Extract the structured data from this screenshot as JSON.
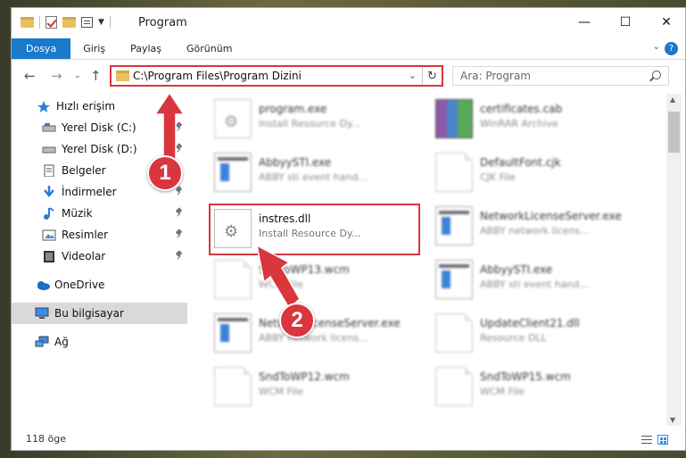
{
  "window": {
    "title": "Program",
    "controls": {
      "minimize": "—",
      "maximize": "☐",
      "close": "✕"
    }
  },
  "ribbon": {
    "tabs": [
      {
        "label": "Dosya",
        "active": true
      },
      {
        "label": "Giriş"
      },
      {
        "label": "Paylaş"
      },
      {
        "label": "Görünüm"
      }
    ],
    "help": "?"
  },
  "navbar": {
    "back": "←",
    "forward": "→",
    "recent": "⌄",
    "up": "↑",
    "address": "C:\\Program Files\\Program Dizini",
    "refresh": "↻",
    "search_placeholder": "Ara: Program"
  },
  "sidebar": {
    "items": [
      {
        "label": "Hızlı erişim",
        "icon": "star-icon"
      },
      {
        "label": "Yerel Disk (C:)",
        "icon": "drive-icon",
        "pinned": true
      },
      {
        "label": "Yerel Disk (D:)",
        "icon": "drive-icon",
        "pinned": true
      },
      {
        "label": "Belgeler",
        "icon": "documents-icon",
        "pinned": true
      },
      {
        "label": "İndirmeler",
        "icon": "download-icon",
        "pinned": true
      },
      {
        "label": "Müzik",
        "icon": "music-icon",
        "pinned": true
      },
      {
        "label": "Resimler",
        "icon": "pictures-icon",
        "pinned": true
      },
      {
        "label": "Videolar",
        "icon": "videos-icon",
        "pinned": true
      },
      {
        "label": "OneDrive",
        "icon": "cloud-icon"
      },
      {
        "label": "Bu bilgisayar",
        "icon": "computer-icon",
        "selected": true
      },
      {
        "label": "Ağ",
        "icon": "network-icon"
      }
    ]
  },
  "files": [
    {
      "name": "program.exe",
      "desc": "Install Resource Dy...",
      "thumb": "installer"
    },
    {
      "name": "certificates.cab",
      "desc": "WinRAR Archive",
      "thumb": "rar"
    },
    {
      "name": "AbbyySTI.exe",
      "desc": "ABBY sti event hand...",
      "thumb": "app"
    },
    {
      "name": "DefaultFont.cjk",
      "desc": "CJK File",
      "thumb": "doc"
    },
    {
      "name": "instres.dll",
      "desc": "Install Resource Dy...",
      "thumb": "gear"
    },
    {
      "name": "NetworkLicenseServer.exe",
      "desc": "ABBY network licens...",
      "thumb": "app"
    },
    {
      "name": "SndToWP13.wcm",
      "desc": "WCM File",
      "thumb": "doc"
    },
    {
      "name": "AbbyySTI.exe",
      "desc": "ABBY sti event hand...",
      "thumb": "app"
    },
    {
      "name": "NetworkLicenseServer.exe",
      "desc": "ABBY network licens...",
      "thumb": "app"
    },
    {
      "name": "UpdateClient21.dll",
      "desc": "Resource DLL",
      "thumb": "doc"
    },
    {
      "name": "SndToWP12.wcm",
      "desc": "WCM File",
      "thumb": "doc"
    },
    {
      "name": "SndToWP15.wcm",
      "desc": "WCM File",
      "thumb": "doc"
    }
  ],
  "status": {
    "count": "118 öge"
  },
  "annotations": {
    "step1": "1",
    "step2": "2"
  },
  "colors": {
    "accent": "#1979ca",
    "highlight": "#d9363e"
  }
}
